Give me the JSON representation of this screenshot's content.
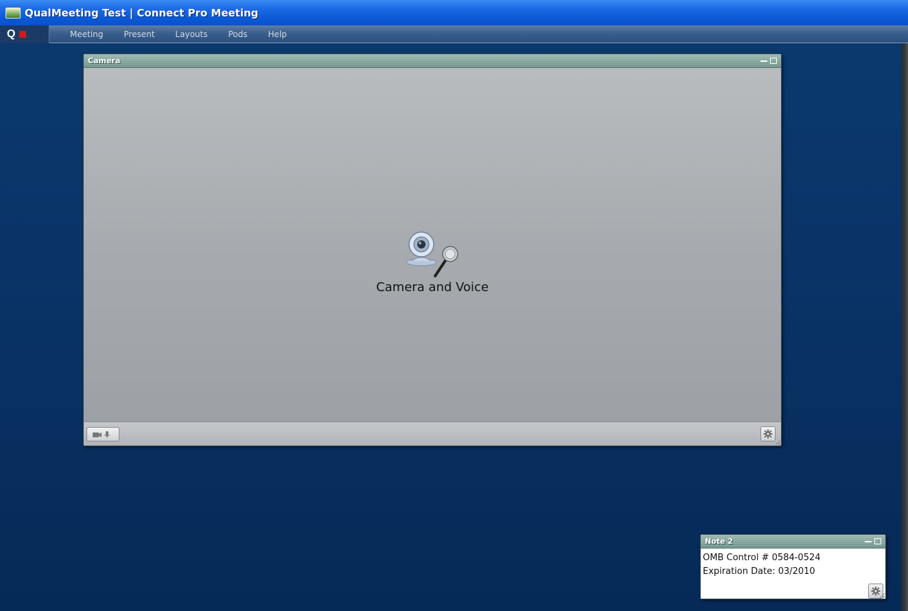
{
  "window": {
    "title": "QualMeeting Test | Connect Pro Meeting",
    "icon": "app-icon"
  },
  "menubar": {
    "logo_letter": "Q",
    "items": [
      "Meeting",
      "Present",
      "Layouts",
      "Pods",
      "Help"
    ]
  },
  "camera_pod": {
    "title": "Camera",
    "center_label": "Camera and Voice",
    "icons": [
      "webcam-icon",
      "microphone-icon"
    ],
    "footer_buttons": [
      "camera-voice-toggle",
      "pod-options-gear"
    ]
  },
  "note_pod": {
    "title": "Note 2",
    "lines": [
      "OMB Control # 0584-0524",
      "Expiration Date:  03/2010"
    ]
  },
  "colors": {
    "titlebar": "#1f6ee6",
    "background": "#0a3468",
    "pod_header": "#7b9c94",
    "stop_button": "#d21a1a"
  }
}
